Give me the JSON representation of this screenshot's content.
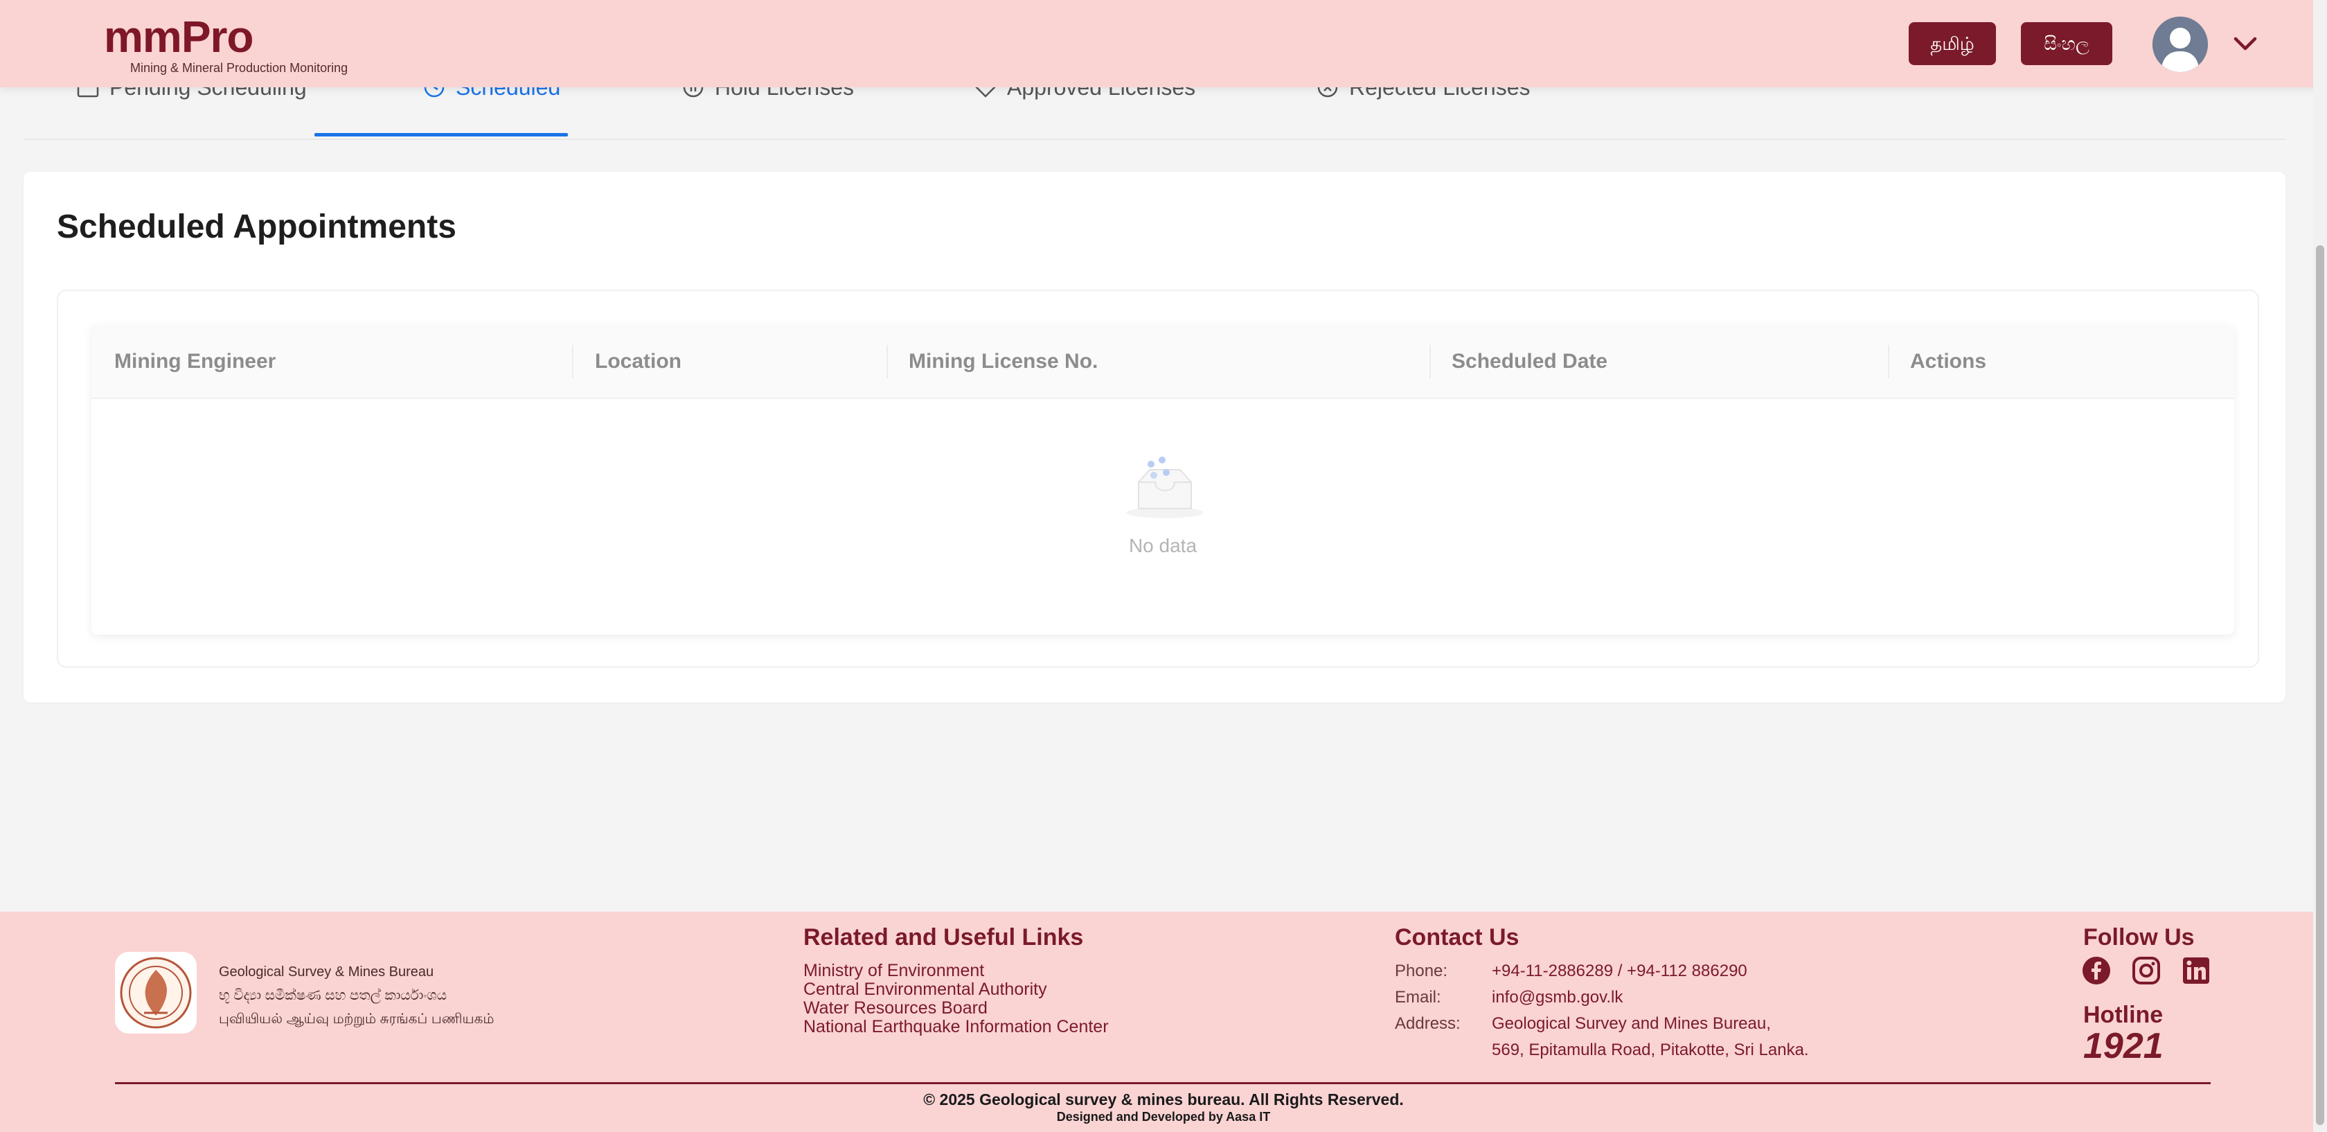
{
  "header": {
    "brand": "mmPro",
    "tagline": "Mining & Mineral Production Monitoring",
    "lang_tamil": "தமிழ்",
    "lang_sinhala": "සිංහල",
    "avatar_icon": "user-avatar-icon",
    "menu_icon": "chevron-down-icon"
  },
  "tabs": [
    {
      "label": "Pending Scheduling",
      "icon": "calendar-icon",
      "active": false
    },
    {
      "label": "Scheduled",
      "icon": "clock-icon",
      "active": true
    },
    {
      "label": "Hold Licenses",
      "icon": "pause-circle-icon",
      "active": false
    },
    {
      "label": "Approved Licenses",
      "icon": "tag-icon",
      "active": false
    },
    {
      "label": "Rejected Licenses",
      "icon": "close-circle-icon",
      "active": false
    }
  ],
  "main": {
    "title": "Scheduled Appointments",
    "table": {
      "columns": [
        "Mining Engineer",
        "Location",
        "Mining License No.",
        "Scheduled Date",
        "Actions"
      ],
      "rows": [],
      "empty_text": "No data"
    }
  },
  "footer": {
    "org_lines": [
      "Geological Survey & Mines Bureau",
      "භූ විද්‍යා සමීක්ෂණ සහ පතල් කාර්යාංශය",
      "புவியியல் ஆய்வு மற்றும் சுரங்கப் பணியகம்"
    ],
    "links_title": "Related and Useful Links",
    "links": [
      "Ministry of Environment",
      "Central Environmental Authority",
      "Water Resources Board",
      "National Earthquake Information Center"
    ],
    "contact_title": "Contact Us",
    "phone_label": "Phone:",
    "phone": "+94-11-2886289 / +94-112 886290",
    "email_label": "Email:",
    "email": "info@gsmb.gov.lk",
    "address_label": "Address:",
    "address_line1": "Geological Survey and Mines Bureau,",
    "address_line2": "569, Epitamulla Road, Pitakotte, Sri Lanka.",
    "follow_title": "Follow Us",
    "social": [
      "facebook-icon",
      "instagram-icon",
      "linkedin-icon"
    ],
    "hotline_title": "Hotline",
    "hotline": "1921",
    "copyright": "© 2025 Geological survey & mines bureau. All Rights Reserved.",
    "designed_by": "Designed and Developed by Aasa IT"
  },
  "colors": {
    "header_bg": "#fad3d3",
    "brand": "#7e1727",
    "accent": "#1a73e8",
    "button_bg": "#7a1a2a"
  }
}
